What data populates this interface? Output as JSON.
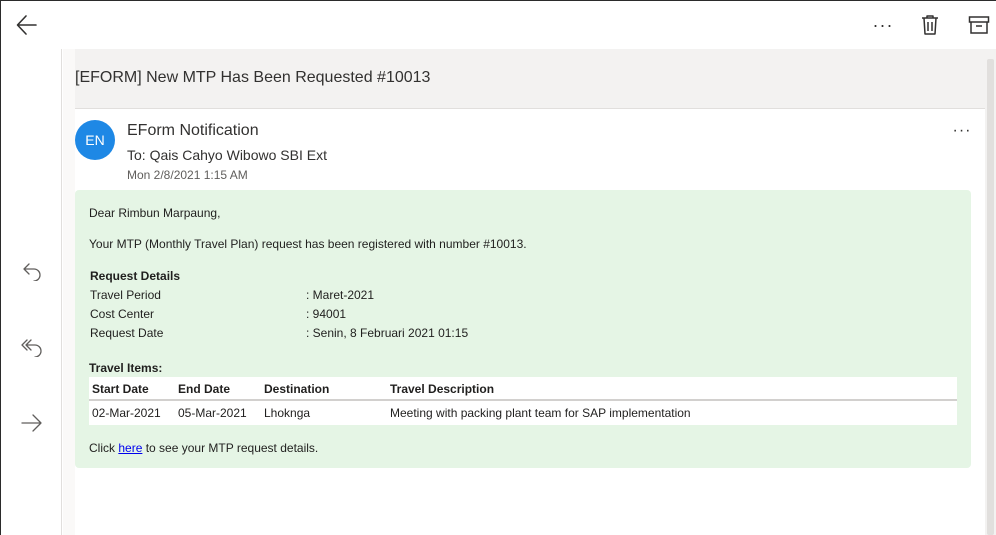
{
  "toolbar": {
    "back_icon": "arrow-left-icon",
    "more_label": "···",
    "delete_icon": "trash-icon",
    "archive_icon": "archive-icon"
  },
  "rail": {
    "reply_icon": "reply-icon",
    "reply_all_icon": "reply-all-icon",
    "forward_icon": "forward-icon"
  },
  "message": {
    "subject": "[EFORM] New MTP Has Been Requested #10013",
    "avatar_initials": "EN",
    "sender": "EForm Notification",
    "to": "To: Qais Cahyo Wibowo SBI Ext",
    "date": "Mon 2/8/2021 1:15 AM",
    "more_label": "···",
    "colors": {
      "avatar": "#1e88e5",
      "body_bg": "#e5f5e5",
      "link": "#0000ee"
    }
  },
  "body": {
    "greeting": "Dear Rimbun Marpaung,",
    "intro": "Your MTP (Monthly Travel Plan) request has been registered with number #10013.",
    "request_details_title": "Request Details",
    "request_details": [
      {
        "label": "Travel Period",
        "value": ": Maret-2021"
      },
      {
        "label": "Cost Center",
        "value": ": 94001"
      },
      {
        "label": "Request Date",
        "value": ": Senin, 8 Februari 2021 01:15"
      }
    ],
    "travel_items_title": "Travel Items:",
    "travel_items_headers": [
      "Start Date",
      "End Date",
      "Destination",
      "Travel Description"
    ],
    "travel_items_rows": [
      [
        "02-Mar-2021",
        "05-Mar-2021",
        "Lhoknga",
        "Meeting with packing plant team for SAP implementation"
      ]
    ],
    "footer_prefix": "Click ",
    "footer_link": "here",
    "footer_suffix": " to see your MTP request details."
  }
}
